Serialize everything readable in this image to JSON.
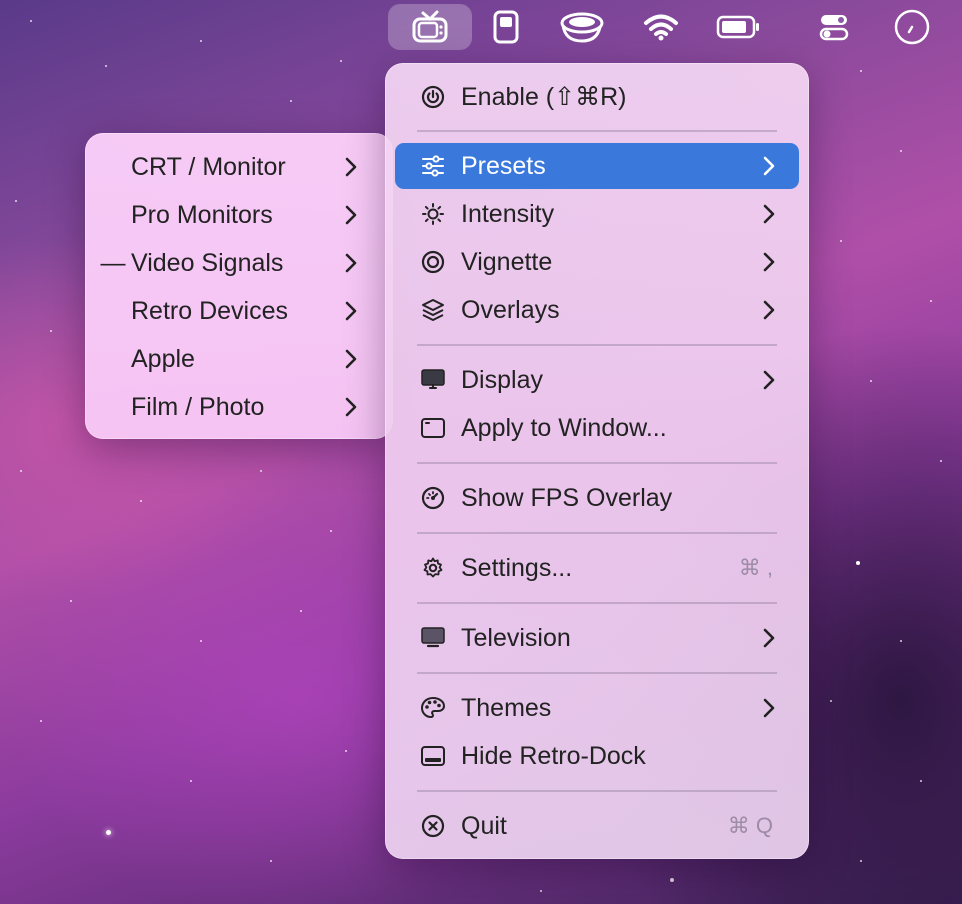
{
  "menubar": {
    "items": [
      {
        "name": "retro-tv-icon",
        "active": true
      },
      {
        "name": "phone-icon"
      },
      {
        "name": "coffee-cup-icon"
      },
      {
        "name": "wifi-icon"
      },
      {
        "name": "battery-icon"
      },
      {
        "name": "control-center-icon"
      },
      {
        "name": "clock-icon"
      }
    ]
  },
  "main_menu": {
    "enable": {
      "label": "Enable (⇧⌘R)",
      "icon": "power-icon"
    },
    "presets": {
      "label": "Presets",
      "icon": "sliders-icon",
      "highlighted": true
    },
    "intensity": {
      "label": "Intensity",
      "icon": "sun-icon"
    },
    "vignette": {
      "label": "Vignette",
      "icon": "target-icon"
    },
    "overlays": {
      "label": "Overlays",
      "icon": "layers-icon"
    },
    "display": {
      "label": "Display",
      "icon": "monitor-icon"
    },
    "apply_window": {
      "label": "Apply to Window...",
      "icon": "window-icon"
    },
    "fps": {
      "label": "Show FPS Overlay",
      "icon": "speedometer-icon"
    },
    "settings": {
      "label": "Settings...",
      "shortcut": "⌘ ,",
      "icon": "gear-icon"
    },
    "television": {
      "label": "Television",
      "icon": "tv-icon"
    },
    "themes": {
      "label": "Themes",
      "icon": "palette-icon"
    },
    "hide_dock": {
      "label": "Hide Retro-Dock",
      "icon": "dock-icon"
    },
    "quit": {
      "label": "Quit",
      "shortcut": "⌘ Q",
      "icon": "close-circle-icon"
    }
  },
  "presets_submenu": {
    "items": [
      {
        "label": "CRT / Monitor",
        "selected": false
      },
      {
        "label": "Pro Monitors",
        "selected": false
      },
      {
        "label": "Video Signals",
        "selected": true,
        "mark": "—"
      },
      {
        "label": "Retro Devices",
        "selected": false
      },
      {
        "label": "Apple",
        "selected": false
      },
      {
        "label": "Film / Photo",
        "selected": false
      }
    ]
  },
  "colors": {
    "highlight": "#3a78dc",
    "menu_bg": "#f2d2f2",
    "text": "#222222",
    "shortcut": "#9c8ca6"
  }
}
